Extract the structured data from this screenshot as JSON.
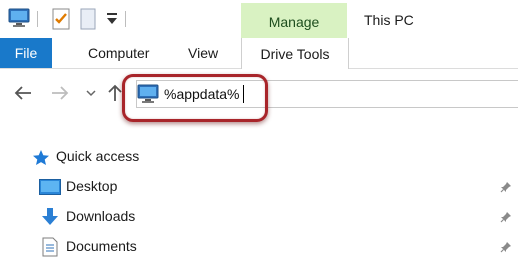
{
  "window": {
    "title": "This PC"
  },
  "quick_access_toolbar": {
    "items": [
      {
        "icon": "computer-icon"
      },
      {
        "icon": "properties-checklist-icon"
      },
      {
        "icon": "new-folder-icon"
      },
      {
        "icon": "customize-dropdown-icon"
      }
    ]
  },
  "ribbon": {
    "context_header": "Manage",
    "tabs": [
      "File",
      "Computer",
      "View",
      "Drive Tools"
    ],
    "colors": {
      "file_tab": "#1979ca",
      "context_band": "#d9f2c2"
    }
  },
  "navigation": {
    "back_icon": "arrow-left-icon",
    "forward_icon": "arrow-right-icon",
    "recent_icon": "chevron-down-icon",
    "up_icon": "arrow-up-icon"
  },
  "address_bar": {
    "value": "%appdata%",
    "icon": "computer-icon",
    "highlight_color": "#a8252a"
  },
  "nav_pane": {
    "items": [
      {
        "label": "Quick access",
        "icon": "star-icon",
        "pinned": false
      },
      {
        "label": "Desktop",
        "icon": "desktop-folder-icon",
        "pinned": true
      },
      {
        "label": "Downloads",
        "icon": "download-arrow-icon",
        "pinned": true
      },
      {
        "label": "Documents",
        "icon": "document-icon",
        "pinned": true
      }
    ]
  }
}
